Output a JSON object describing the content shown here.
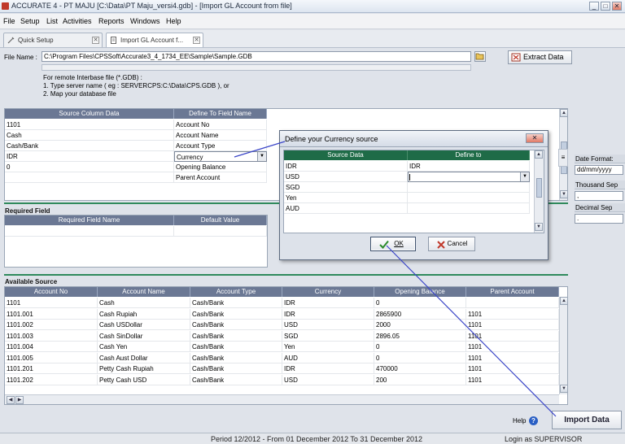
{
  "window": {
    "title": "ACCURATE 4 - PT MAJU   [C:\\Data\\PT Maju_versi4.gdb] - [Import GL Account from file]",
    "minimize": "_",
    "restore": "□",
    "close": "✕"
  },
  "menu": [
    "File",
    "Setup",
    "List",
    "Activities",
    "Reports",
    "Windows",
    "Help"
  ],
  "tabs": [
    {
      "label": "Quick Setup",
      "close": "✕"
    },
    {
      "label": "Import GL Account f...",
      "close": "✕"
    }
  ],
  "file": {
    "label": "File Name :",
    "value": "C:\\Program Files\\CPSSoft\\Accurate3_4_1734_EE\\Sample\\Sample.GDB",
    "extract_label": "Extract Data",
    "hint_lines": [
      "For remote Interbase file (*.GDB) :",
      "1. Type server name ( eg : SERVERCPS:C:\\Data\\CPS.GDB ), or",
      "2. Map your database file"
    ]
  },
  "mapping": {
    "headers": [
      "Source Column Data",
      "Define To Field Name"
    ],
    "rows": [
      [
        "1101",
        "Account No"
      ],
      [
        "Cash",
        "Account Name"
      ],
      [
        "Cash/Bank",
        "Account Type"
      ],
      [
        "IDR",
        "Currency"
      ],
      [
        "0",
        "Opening Balance"
      ],
      [
        "",
        "Parent Account"
      ]
    ],
    "dropdown_arrow": "▼"
  },
  "required": {
    "title": "Required Field",
    "headers": [
      "Required Field Name",
      "Default Value"
    ]
  },
  "available": {
    "title": "Available Source",
    "headers": [
      "Account No",
      "Account Name",
      "Account Type",
      "Currency",
      "Opening Balance",
      "Parent Account"
    ],
    "rows": [
      [
        "1101",
        "Cash",
        "Cash/Bank",
        "IDR",
        "0",
        ""
      ],
      [
        "1101.001",
        "Cash Rupiah",
        "Cash/Bank",
        "IDR",
        "2865900",
        "1101"
      ],
      [
        "1101.002",
        "Cash USDollar",
        "Cash/Bank",
        "USD",
        "2000",
        "1101"
      ],
      [
        "1101.003",
        "Cash SinDollar",
        "Cash/Bank",
        "SGD",
        "2896.05",
        "1101"
      ],
      [
        "1101.004",
        "Cash Yen",
        "Cash/Bank",
        "Yen",
        "0",
        "1101"
      ],
      [
        "1101.005",
        "Cash Aust Dollar",
        "Cash/Bank",
        "AUD",
        "0",
        "1101"
      ],
      [
        "1101.201",
        "Petty Cash Rupiah",
        "Cash/Bank",
        "IDR",
        "470000",
        "1101"
      ],
      [
        "1101.202",
        "Petty Cash USD",
        "Cash/Bank",
        "USD",
        "200",
        "1101"
      ]
    ]
  },
  "dialog": {
    "title": "Define your Currency source",
    "close": "✕",
    "headers": [
      "Source Data",
      "Define to"
    ],
    "rows": [
      [
        "IDR",
        "IDR"
      ],
      [
        "USD",
        ""
      ],
      [
        "SGD",
        ""
      ],
      [
        "Yen",
        ""
      ],
      [
        "AUD",
        ""
      ]
    ],
    "ok_label": "OK",
    "cancel_label": "Cancel"
  },
  "right_panel": {
    "date_format_label": "Date Format:",
    "date_format_value": "dd/mm/yyyy",
    "thousand_sep_label": "Thousand Sep",
    "thousand_sep_value": ",",
    "decimal_sep_label": "Decimal Sep",
    "decimal_sep_value": "."
  },
  "bottom": {
    "help_label": "Help",
    "import_label": "Import Data"
  },
  "status": {
    "period": "Period 12/2012 - From 01 December 2012 To 31 December 2012",
    "login": "Login as SUPERVISOR"
  },
  "colors": {
    "grid_header": "#6b7894",
    "dialog_header": "#1e6b47",
    "annotation_line": "#3a45c8"
  }
}
